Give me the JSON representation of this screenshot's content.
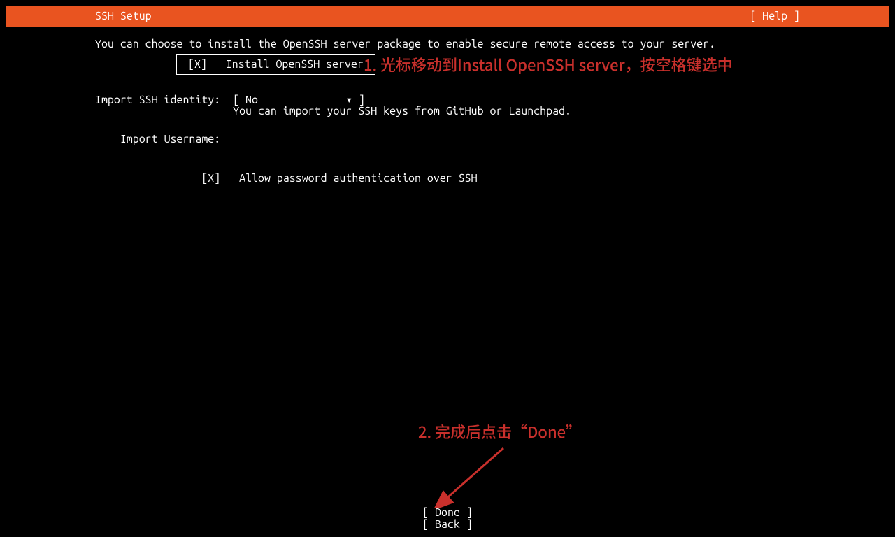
{
  "topbar": {
    "title": "SSH Setup",
    "help": "[ Help ]"
  },
  "intro": "You can choose to install the OpenSSH server package to enable secure remote access to your server.",
  "install": {
    "bracket_open": "[",
    "mark": "X",
    "bracket_close": "]",
    "label": "Install OpenSSH server"
  },
  "annotations": {
    "a1": "1. 光标移动到Install OpenSSH server，按空格键选中",
    "a2": "2. 完成后点击“Done”"
  },
  "import_identity": {
    "label": "Import SSH identity:",
    "value_open": "[ ",
    "value": "No",
    "value_tri": "▾",
    "value_close": " ]",
    "hint": "You can import your SSH keys from GitHub or Launchpad."
  },
  "import_username": {
    "label": "Import Username:"
  },
  "allow_pw": {
    "checkbox": "[X]",
    "label": "Allow password authentication over SSH"
  },
  "footer": {
    "done": "[ Done       ]",
    "back": "[ Back       ]"
  }
}
